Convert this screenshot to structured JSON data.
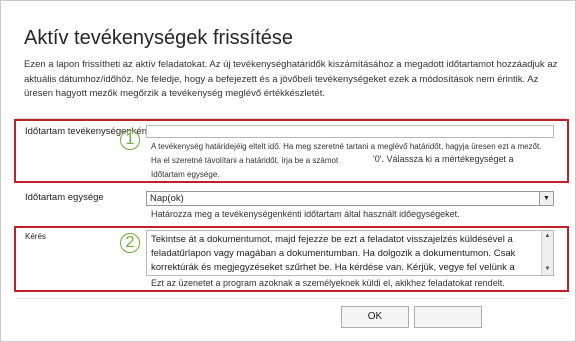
{
  "dialog": {
    "title": "Aktív tevékenységek frissítése",
    "description": "Ezen a lapon frissítheti az aktív feladatokat. Az új tevékenységhatáridők kiszámításához a megadott időtartamot hozzáadjuk az aktuális dátumhoz/időhöz. Ne feledje, hogy a befejezett és a jövőbeli tevékenységeket ezek a módosítások nem érintik. Az üresen hagyott mezők megőrzik a tevékenység meglévő értékkészletét."
  },
  "duration": {
    "label": "Időtartam tevékenységenként",
    "value": "",
    "help_line1": "A tevékenység határidejéig eltelt idő. Ha meg szeretné tartani a meglévő határidőt, hagyja üresen ezt a mezőt.",
    "help_line2_a": "Ha el szeretné távolítani a határidőt, írja be a számot",
    "help_line2_b": "'0'. Válassza ki a mértékegységet a",
    "help_line3": "Időtartam egysége.",
    "marker": "1"
  },
  "unit": {
    "label": "Időtartam egysége",
    "selected": "Nap(ok)",
    "help": "Határozza meg a tevékenységenkénti időtartam által használt időegységeket."
  },
  "request": {
    "label": "Kérés",
    "text": "Tekintse át a dokumentumot, majd fejezze be ezt a feladatot visszajelzés küldésével a feladatűrlapon vagy magában a dokumentumban. Ha dolgozik a dokumentumon. Csak korrektúrák és megjegyzéseket szűrhet be. Ha kérdése van. Kérjük, vegye fel velünk a kapcsolatot. - Frank",
    "help": "Ezt az üzenetet a program azoknak a személyeknek küldi el, akikhez feladatokat rendelt.",
    "marker": "2"
  },
  "buttons": {
    "ok": "OK",
    "cancel": "Mégse"
  }
}
